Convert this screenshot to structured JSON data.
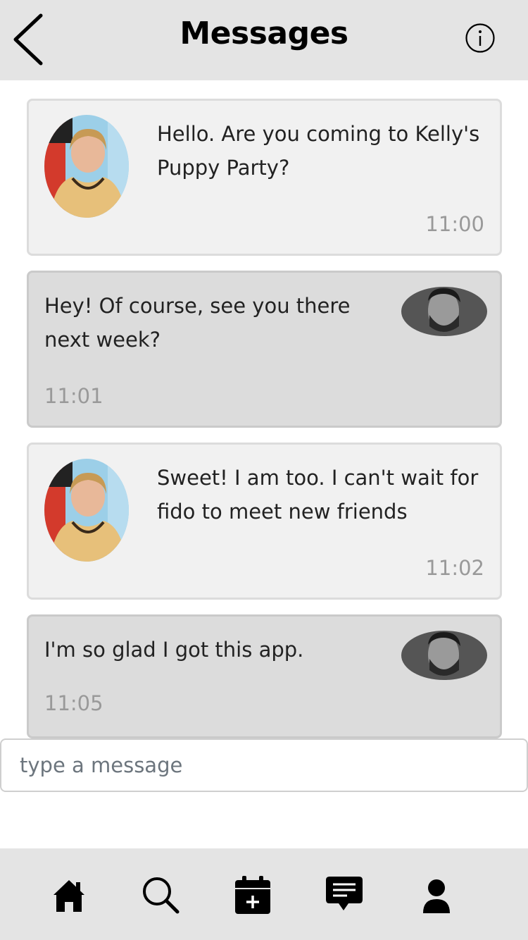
{
  "header": {
    "title": "Messages",
    "back_icon": "chevron-left-icon",
    "info_icon": "info-circle-icon"
  },
  "messages": [
    {
      "direction": "incoming",
      "text": "Hello. Are you coming to Kelly's Puppy Party?",
      "time": "11:00",
      "avatar": "avatar-woman"
    },
    {
      "direction": "outgoing",
      "text": "Hey! Of course, see you there next week?",
      "time": "11:01",
      "avatar": "avatar-man"
    },
    {
      "direction": "incoming",
      "text": "Sweet! I am too. I can't wait for fido to meet new friends",
      "time": "11:02",
      "avatar": "avatar-woman"
    },
    {
      "direction": "outgoing",
      "text": "I'm so glad I got this app.",
      "time": "11:05",
      "avatar": "avatar-man"
    }
  ],
  "composer": {
    "placeholder": "type a message",
    "value": ""
  },
  "nav": {
    "items": [
      "home-icon",
      "search-icon",
      "calendar-add-icon",
      "chat-icon",
      "user-icon"
    ]
  },
  "colors": {
    "header_bg": "#e4e4e4",
    "incoming_bg": "#f1f1f1",
    "outgoing_bg": "#dcdcdc",
    "time_text": "#999999"
  }
}
